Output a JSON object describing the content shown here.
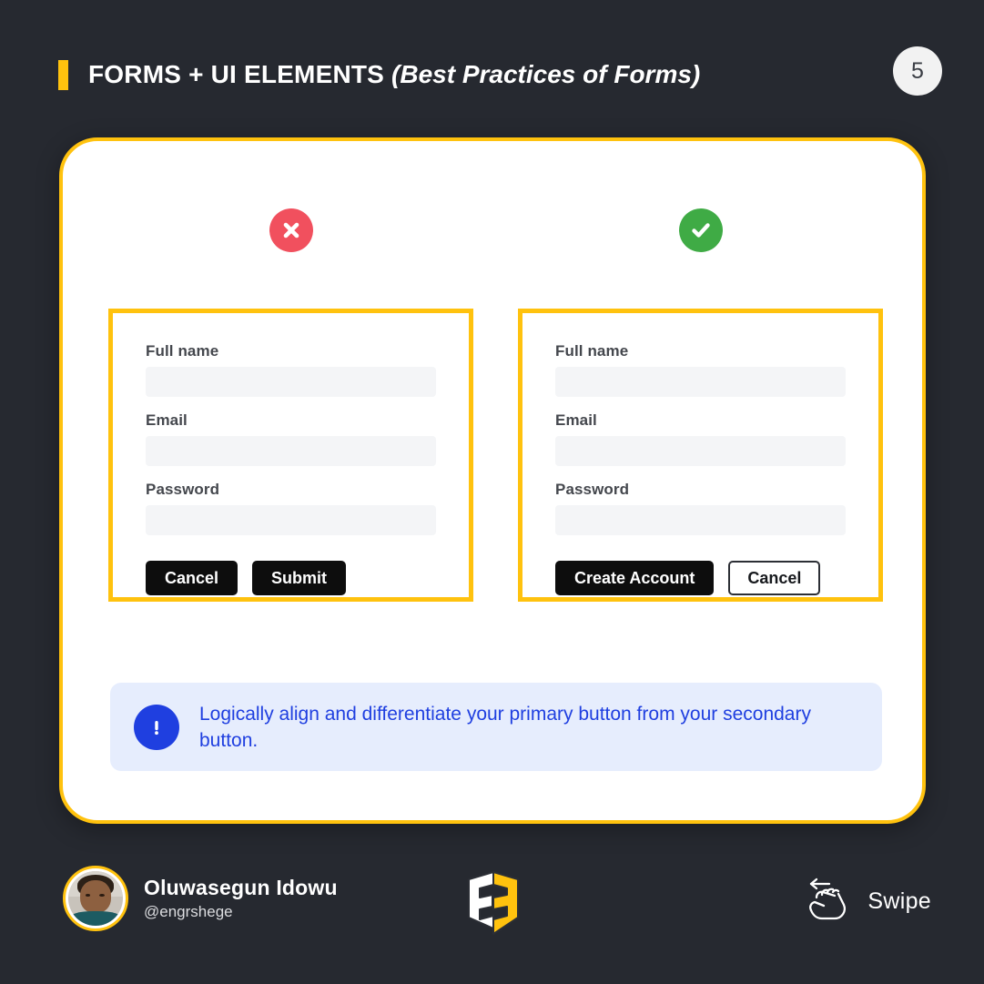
{
  "theme": {
    "background": "#262930",
    "accent_gold": "#ffc20e",
    "card_white": "#ffffff",
    "primary_black": "#0d0d0d",
    "bad_red": "#f1505e",
    "good_green": "#3fab45",
    "callout_blue": "#1f3fe0",
    "callout_bg": "#e6edfd",
    "input_gray": "#f4f5f7"
  },
  "header": {
    "title": "FORMS + UI ELEMENTS ",
    "subtitle": "(Best Practices of Forms)",
    "page_number": "5"
  },
  "status": {
    "bad_icon": "circle-x-icon",
    "good_icon": "circle-check-icon"
  },
  "forms": [
    {
      "variant": "bad",
      "fields": [
        {
          "label": "Full name",
          "value": "",
          "placeholder": ""
        },
        {
          "label": "Email",
          "value": "",
          "placeholder": ""
        },
        {
          "label": "Password",
          "value": "",
          "placeholder": ""
        }
      ],
      "buttons": [
        {
          "label": "Cancel",
          "style": "primary"
        },
        {
          "label": "Submit",
          "style": "primary"
        }
      ]
    },
    {
      "variant": "good",
      "fields": [
        {
          "label": "Full name",
          "value": "",
          "placeholder": ""
        },
        {
          "label": "Email",
          "value": "",
          "placeholder": ""
        },
        {
          "label": "Password",
          "value": "",
          "placeholder": ""
        }
      ],
      "buttons": [
        {
          "label": "Create Account",
          "style": "primary"
        },
        {
          "label": "Cancel",
          "style": "secondary"
        }
      ]
    }
  ],
  "callout": {
    "icon": "exclamation-icon",
    "text": "Logically align and differentiate your primary button from your secondary button."
  },
  "footer": {
    "author_name": "Oluwasegun Idowu",
    "author_handle": "@engrshege",
    "avatar": "avatar",
    "brand_logo": "es-shield-logo",
    "swipe_label": "Swipe",
    "swipe_icon": "swipe-hand-icon"
  }
}
